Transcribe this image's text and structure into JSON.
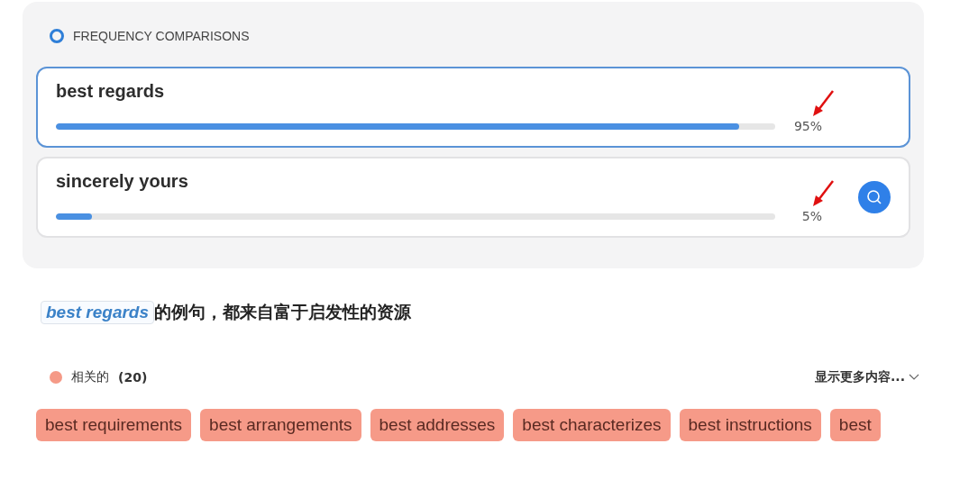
{
  "frequency": {
    "title": "FREQUENCY COMPARISONS",
    "items": [
      {
        "phrase": "best regards",
        "level": 0.95,
        "reading": "95%",
        "selected": true,
        "annotated": true,
        "search_button": false
      },
      {
        "phrase": "sincerely yours",
        "level": 0.05,
        "reading": "5%",
        "selected": false,
        "annotated": true,
        "search_button": true
      }
    ]
  },
  "examples": {
    "phrase": "best regards",
    "text": "的例句，都来自富于启发性的资源"
  },
  "related": {
    "label": "相关的",
    "count": "(20)",
    "color": "#f59a87",
    "more": "显示更多内容...",
    "tags": [
      "best requirements",
      "best arrangements",
      "best addresses",
      "best characterizes",
      "best instructions",
      "best"
    ]
  }
}
